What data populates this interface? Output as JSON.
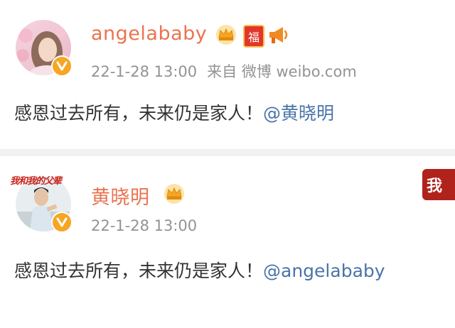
{
  "post1": {
    "username": "angelababy",
    "time": "22-1-28 13:00",
    "source": "来自 微博 weibo.com",
    "text": "感恩过去所有，未来仍是家人！",
    "mention": "@黄晓明",
    "badge_fu": "福"
  },
  "post2": {
    "username": "黄晓明",
    "time": "22-1-28 13:00",
    "text": "感恩过去所有，未来仍是家人！",
    "mention": "@angelababy",
    "avatar_banner": "我和我的父辈",
    "corner_banner": "我"
  },
  "colors": {
    "name": "#eb7350",
    "meta": "#939393",
    "mention": "#4a74a8",
    "verified": "#f6a623"
  },
  "icons": [
    "crown-icon",
    "fu-badge-icon",
    "megaphone-icon",
    "verified-icon"
  ]
}
